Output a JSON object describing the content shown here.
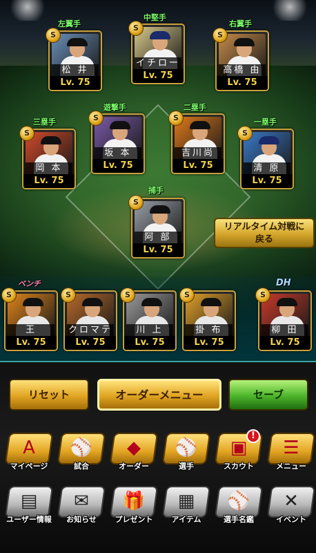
{
  "lineup": {
    "fielders": [
      {
        "position": "左翼手",
        "name": "松 井",
        "level": "Lv. 75",
        "photo_bg": "#6a8fb8",
        "uniform": "#f2f2f2",
        "cap": "#111"
      },
      {
        "position": "中堅手",
        "name": "イチロー",
        "level": "Lv. 75",
        "photo_bg": "#d8c98a",
        "uniform": "#f2f2f2",
        "cap": "#1a2a6a"
      },
      {
        "position": "右翼手",
        "name": "高橋 由",
        "level": "Lv. 75",
        "photo_bg": "#c58a4a",
        "uniform": "#f2f2f2",
        "cap": "#111"
      },
      {
        "position": "三塁手",
        "name": "岡 本",
        "level": "Lv. 75",
        "photo_bg": "#d24a2a",
        "uniform": "#f2f2f2",
        "cap": "#111"
      },
      {
        "position": "遊撃手",
        "name": "坂 本",
        "level": "Lv. 75",
        "photo_bg": "#7a5aa8",
        "uniform": "#f2f2f2",
        "cap": "#111"
      },
      {
        "position": "二塁手",
        "name": "吉川尚",
        "level": "Lv. 75",
        "photo_bg": "#e07a1a",
        "uniform": "#f2f2f2",
        "cap": "#111"
      },
      {
        "position": "一塁手",
        "name": "清 原",
        "level": "Lv. 75",
        "photo_bg": "#3a7ac8",
        "uniform": "#f2f2f2",
        "cap": "#1a2a6a"
      },
      {
        "position": "捕手",
        "name": "阿 部",
        "level": "Lv. 75",
        "photo_bg": "#9aa0a8",
        "uniform": "#f2f2f2",
        "cap": "#111"
      }
    ],
    "bench_label": "ベンチ",
    "dh_label": "DH",
    "bench": [
      {
        "name": "王",
        "level": "Lv. 75",
        "photo_bg": "#e0841a",
        "uniform": "#e8e8e8",
        "cap": "#111"
      },
      {
        "name": "クロマティ",
        "level": "Lv. 75",
        "photo_bg": "#b86a2a",
        "uniform": "#e8e8e8",
        "cap": "#111"
      },
      {
        "name": "川 上",
        "level": "Lv. 75",
        "photo_bg": "#9a9a9a",
        "uniform": "#e8e8e8",
        "cap": "#111"
      },
      {
        "name": "掛 布",
        "level": "Lv. 75",
        "photo_bg": "#e0a02a",
        "uniform": "#e8e8e8",
        "cap": "#111"
      },
      {
        "name": "柳 田",
        "level": "Lv. 75",
        "photo_bg": "#c83a2a",
        "uniform": "#e8e8e8",
        "cap": "#111"
      }
    ],
    "badge_text": "S"
  },
  "realtime_button": {
    "line1": "リアルタイム対戦に",
    "line2": "戻る"
  },
  "actions": {
    "reset": "リセット",
    "order_menu": "オーダーメニュー",
    "save": "セーブ"
  },
  "nav_primary": [
    {
      "label": "マイページ",
      "icon": "mypage-icon",
      "glyph": "A"
    },
    {
      "label": "試合",
      "icon": "match-icon",
      "glyph": "⚾"
    },
    {
      "label": "オーダー",
      "icon": "order-icon",
      "glyph": "◆"
    },
    {
      "label": "選手",
      "icon": "player-icon",
      "glyph": "⚾"
    },
    {
      "label": "スカウト",
      "icon": "scout-icon",
      "glyph": "▣"
    },
    {
      "label": "メニュー",
      "icon": "menu-icon",
      "glyph": "☰"
    }
  ],
  "nav_secondary": [
    {
      "label": "ユーザー情報",
      "icon": "user-info-icon",
      "glyph": "▤"
    },
    {
      "label": "お知らせ",
      "icon": "news-icon",
      "glyph": "✉"
    },
    {
      "label": "プレゼント",
      "icon": "present-icon",
      "glyph": "🎁"
    },
    {
      "label": "アイテム",
      "icon": "item-icon",
      "glyph": "▦"
    },
    {
      "label": "選手名鑑",
      "icon": "player-book-icon",
      "glyph": "⚾"
    },
    {
      "label": "イベント",
      "icon": "event-icon",
      "glyph": "✕"
    }
  ],
  "scout_notice": "!"
}
